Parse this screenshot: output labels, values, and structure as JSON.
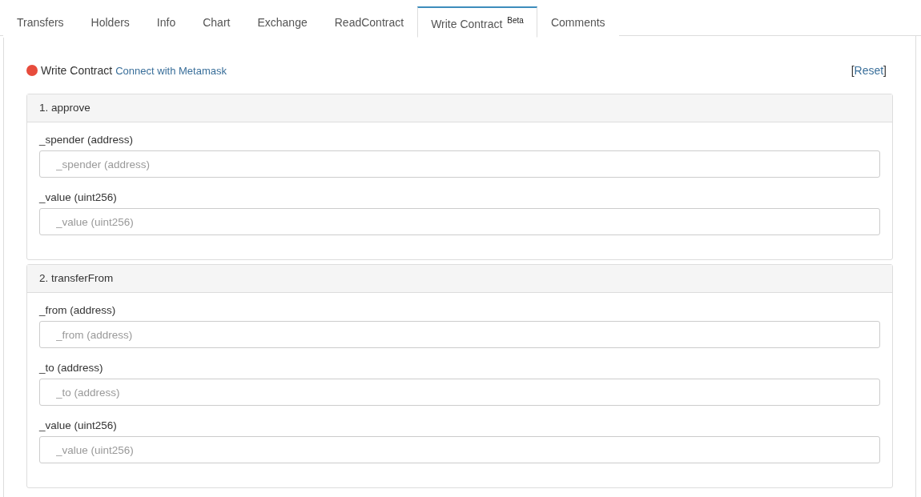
{
  "tabs": [
    {
      "label": "Transfers",
      "selected": false
    },
    {
      "label": "Holders",
      "selected": false
    },
    {
      "label": "Info",
      "selected": false
    },
    {
      "label": "Chart",
      "selected": false
    },
    {
      "label": "Exchange",
      "selected": false
    },
    {
      "label": "ReadContract",
      "selected": false
    },
    {
      "label": "Write Contract",
      "badge": "Beta",
      "selected": true
    },
    {
      "label": "Comments",
      "selected": false
    }
  ],
  "header": {
    "title": "Write Contract",
    "connect_link": "Connect with Metamask",
    "reset_open": "[",
    "reset_link": "Reset",
    "reset_close": "]"
  },
  "functions": [
    {
      "title": "1. approve",
      "params": [
        {
          "label": "_spender (address)",
          "placeholder": "_spender (address)"
        },
        {
          "label": "_value (uint256)",
          "placeholder": "_value (uint256)"
        }
      ]
    },
    {
      "title": "2. transferFrom",
      "params": [
        {
          "label": "_from (address)",
          "placeholder": "_from (address)"
        },
        {
          "label": "_to (address)",
          "placeholder": "_to (address)"
        },
        {
          "label": "_value (uint256)",
          "placeholder": "_value (uint256)"
        }
      ]
    }
  ]
}
